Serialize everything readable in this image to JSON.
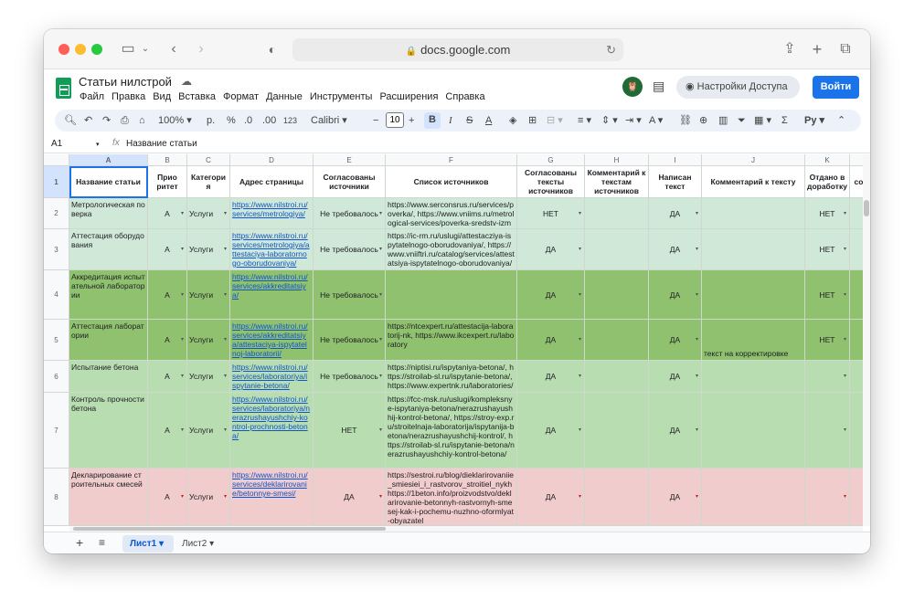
{
  "browser": {
    "url": "docs.google.com"
  },
  "doc": {
    "title": "Статьи нилстрой",
    "menus": [
      "Файл",
      "Правка",
      "Вид",
      "Вставка",
      "Формат",
      "Данные",
      "Инструменты",
      "Расширения",
      "Справка"
    ],
    "avatar": "🦉",
    "access_button": "Настройки Доступа",
    "login_button": "Войти"
  },
  "toolbar": {
    "zoom": "100%",
    "currency": "р.",
    "percent": "%",
    "dec_less": ".0",
    "dec_more": ".00",
    "number_fmt": "123",
    "font": "Calibri",
    "font_size": "10"
  },
  "formula_bar": {
    "cell_ref": "A1",
    "fx": "fx",
    "value": "Название статьи"
  },
  "columns": [
    "A",
    "B",
    "C",
    "D",
    "E",
    "F",
    "G",
    "H",
    "I",
    "J",
    "K"
  ],
  "header_row": {
    "num": "1",
    "A": "Название статьи",
    "B": "Приo ритет",
    "C": "Категори я",
    "D": "Адрес страницы",
    "E": "Согласованы источники",
    "F": "Список источников",
    "G": "Согласованы тексты источников",
    "H": "Комментарий к текстам источников",
    "I": "Написан текст",
    "J": "Комментарий к тексту",
    "K": "Отдано в доработку",
    "L": "со"
  },
  "rows": [
    {
      "num": "2",
      "A": "Метрологическая поверка",
      "B": "А",
      "C": "Услуги",
      "D": "https://www.nilstroi.ru/services/metrologiya/",
      "E": "Не требовалось",
      "F": "https://www.serconsrus.ru/services/poverka/, https://www.vniims.ru/metrological-services/poverka-sredstv-izmereniy/",
      "G": "НЕТ",
      "H": "",
      "I": "ДА",
      "J": "",
      "K": "НЕТ"
    },
    {
      "num": "3",
      "A": "Аттестация оборудования",
      "B": "А",
      "C": "Услуги",
      "D": "https://www.nilstroi.ru/services/metrologiya/attestaciya-laboratornogo-oborudovaniya/",
      "E": "Не требовалось",
      "F": "https://ic-rm.ru/uslugi/attestacziya-ispytatelnogo-oborudovaniya/, https://www.vniiftri.ru/catalog/services/attestatsiya-ispytatelnogo-oborudovaniya/",
      "G": "ДА",
      "H": "",
      "I": "ДА",
      "J": "",
      "K": "НЕТ"
    },
    {
      "num": "4",
      "A": "Аккредитация испытательной лаборатории",
      "B": "А",
      "C": "Услуги",
      "D": "https://www.nilstroi.ru/services/akkreditatsiya/",
      "E": "Не требовалось",
      "F": "",
      "G": "ДА",
      "H": "",
      "I": "ДА",
      "J": "",
      "K": "НЕТ"
    },
    {
      "num": "5",
      "A": "Аттестация лаборатории",
      "B": "А",
      "C": "Услуги",
      "D": "https://www.nilstroi.ru/services/akkreditatsiya/attestaciya-ispytatelnoj-laboratorii/",
      "E": "Не требовалось",
      "F": "https://ntcexpert.ru/attestacija-laboratorij-nk, https://www.ikcexpert.ru/laboratory",
      "G": "ДА",
      "H": "",
      "I": "ДА",
      "J": "текст на корректировке",
      "K": "НЕТ"
    },
    {
      "num": "6",
      "A": "Испытание бетона",
      "B": "А",
      "C": "Услуги",
      "D": "https://www.nilstroi.ru/services/laboratoriya/ispytanie-betona/",
      "E": "Не требовалось",
      "F": "https://niptisi.ru/ispytaniya-betona/, https://stroilab-sl.ru/ispytanie-betona/, https://www.expertnk.ru/laboratories/",
      "G": "ДА",
      "H": "",
      "I": "ДА",
      "J": "",
      "K": ""
    },
    {
      "num": "7",
      "A": "Контроль прочности бетона",
      "B": "А",
      "C": "Услуги",
      "D": "https://www.nilstroi.ru/services/laboratoriya/nerazrushayushchiy-kontrol-prochnosti-betona/",
      "E": "НЕТ",
      "F": "https://fcc-msk.ru/uslugi/kompleksnye-ispytaniya-betona/nerazrushayushhij-kontrol-betona/, https://stroy-exp.ru/stroitelnaja-laboratorija/ispytanija-betona/nerazrushayushchij-kontrol/, https://stroilab-sl.ru/ispytanie-betona/nerazrushayushchiy-kontrol-betona/",
      "G": "ДА",
      "H": "",
      "I": "ДА",
      "J": "",
      "K": ""
    },
    {
      "num": "8",
      "A": "Декларирование строительных смесей",
      "B": "А",
      "C": "Услуги",
      "D": "https://www.nilstroi.ru/services/deklarirovanie/betonnye-smesi/",
      "E": "ДА",
      "F": "https://sestroi.ru/blog/dieklarirovaniie_smiesiei_i_rastvorov_stroitiel_nykh https://1beton.info/proizvodstvo/deklarirovanie-betonnyh-rastvornyh-smesej-kak-i-pochemu-nuzhno-oformlyat-obyazatel",
      "G": "ДА",
      "H": "",
      "I": "ДА",
      "J": "",
      "K": ""
    }
  ],
  "sheet_tabs": [
    "Лист1",
    "Лист2"
  ],
  "colors": {
    "green_light": "#cfe8d8",
    "green_mid": "#b8ddb0",
    "green_dark": "#8fc16f",
    "pink": "#f0cccc",
    "accent": "#1a73e8"
  }
}
